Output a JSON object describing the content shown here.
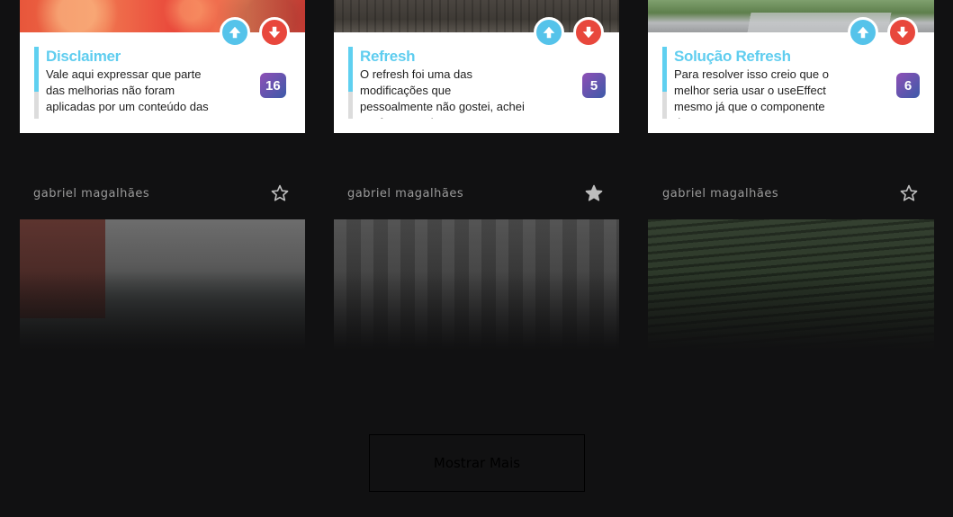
{
  "posts": [
    {
      "title": "Disclaimer",
      "description": "Vale aqui expressar que parte das melhorias não foram aplicadas por um conteúdo das",
      "votes": "16",
      "image_icon": "flower-photo"
    },
    {
      "title": "Refresh",
      "description": "O refresh foi uma das modificações que pessoalmente não gostei, achei um fracasso da",
      "votes": "5",
      "image_icon": "field-photo"
    },
    {
      "title": "Solução Refresh",
      "description": "Para resolver isso creio que o melhor seria usar o useEffect mesmo já que o componente deve",
      "votes": "6",
      "image_icon": "road-photo"
    }
  ],
  "feed": [
    {
      "author": "gabriel magalhães",
      "favorited": false,
      "image_icon": "car-photo"
    },
    {
      "author": "gabriel magalhães",
      "favorited": true,
      "image_icon": "bikes-photo"
    },
    {
      "author": "gabriel magalhães",
      "favorited": false,
      "image_icon": "tea-field-photo"
    }
  ],
  "show_more_label": "Mostrar Mais",
  "colors": {
    "background": "#111112",
    "title": "#5fcdef",
    "upvote": "#55c3ea",
    "downvote": "#e8473c",
    "badge_start": "#8f4fb6",
    "badge_end": "#3c5aa8"
  }
}
